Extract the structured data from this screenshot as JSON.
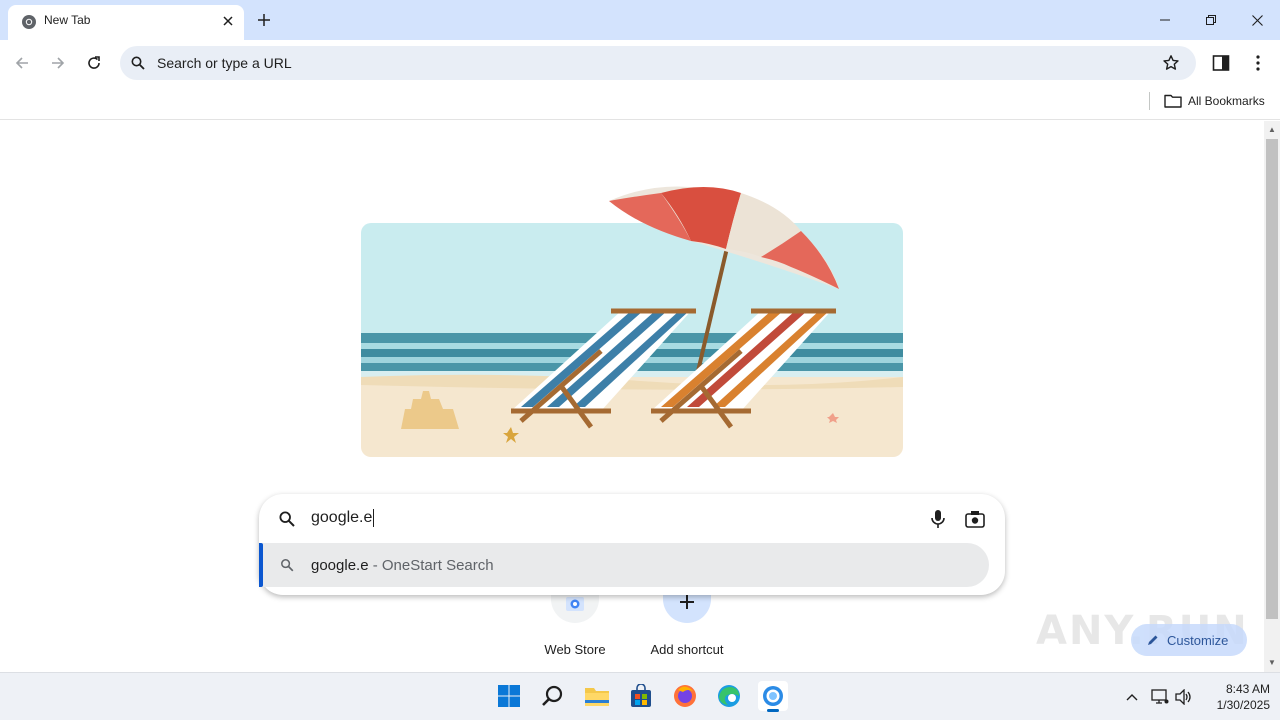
{
  "browser": {
    "tab_title": "New Tab",
    "omnibox_placeholder": "Search or type a URL",
    "bookmarks": {
      "all_bookmarks_label": "All Bookmarks"
    }
  },
  "newtab": {
    "search": {
      "query": "google.e"
    },
    "suggestion": {
      "text": "google.e",
      "suffix": " - OneStart Search"
    },
    "shortcuts": [
      {
        "label": "Web Store",
        "icon": "web-store-icon"
      },
      {
        "label": "Add shortcut",
        "icon": "plus-icon"
      }
    ],
    "customize_label": "Customize",
    "watermark": "ANY.RUN"
  },
  "taskbar": {
    "apps": [
      "start-icon",
      "search-icon",
      "file-explorer-icon",
      "store-icon",
      "firefox-icon",
      "edge-icon",
      "onestart-icon"
    ],
    "clock": {
      "time": "8:43 AM",
      "date": "1/30/2025"
    }
  },
  "colors": {
    "accent": "#0b57d0",
    "tab_strip": "#d3e3fd",
    "omnibox": "#e9eef6"
  }
}
